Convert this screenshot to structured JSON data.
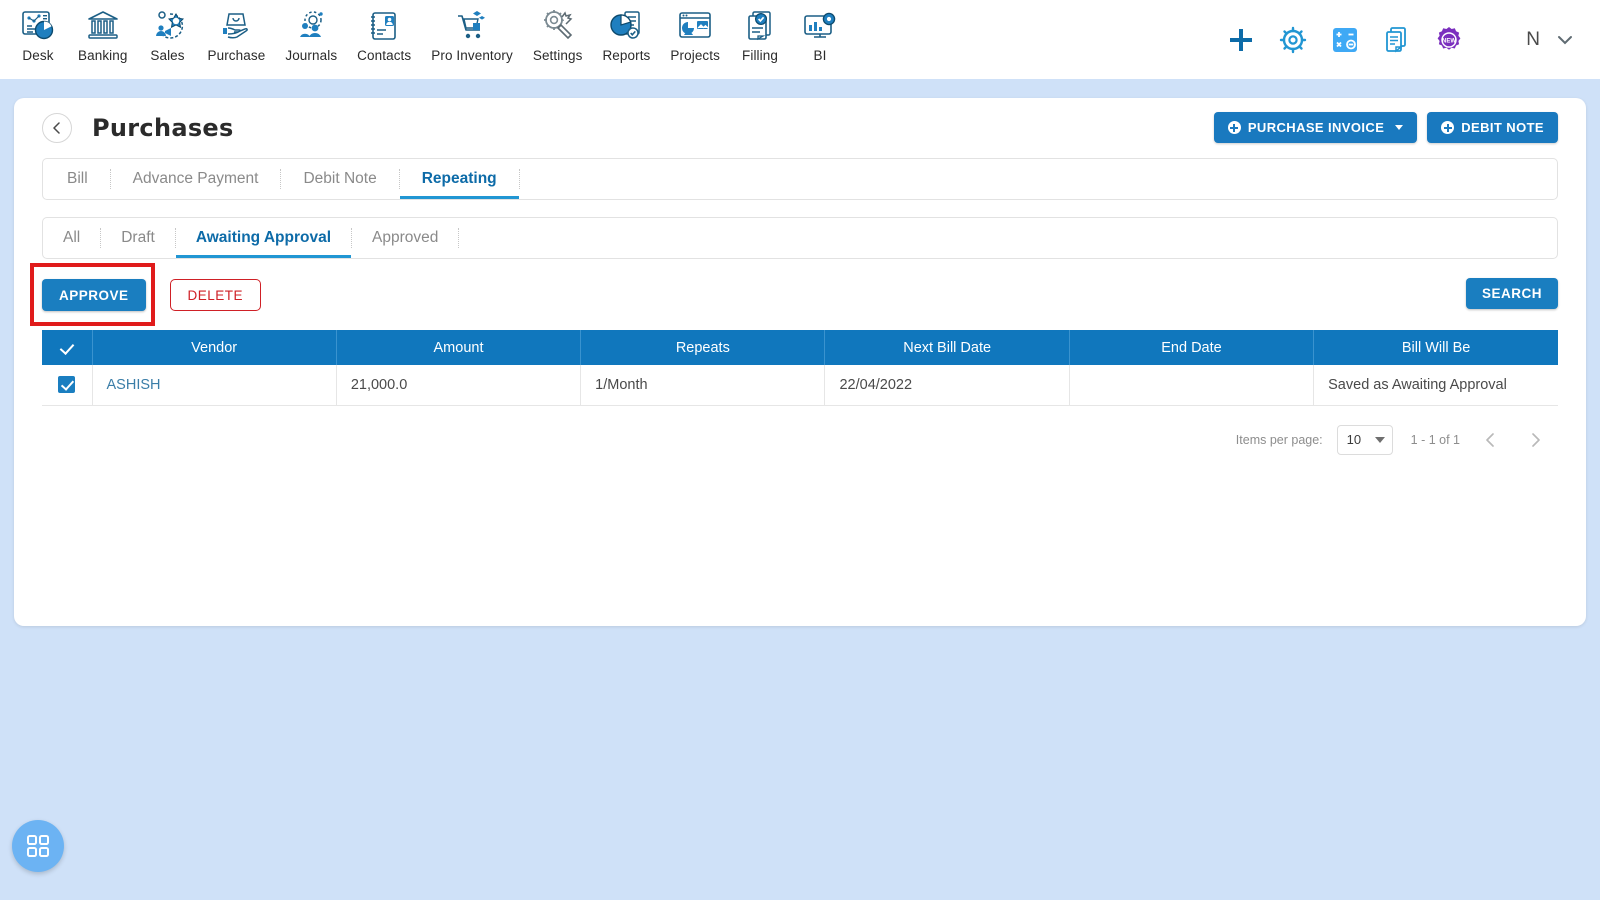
{
  "topnav": {
    "items": [
      {
        "label": "Desk",
        "icon": "dashboard-icon"
      },
      {
        "label": "Banking",
        "icon": "bank-icon"
      },
      {
        "label": "Sales",
        "icon": "sales-icon"
      },
      {
        "label": "Purchase",
        "icon": "purchase-icon"
      },
      {
        "label": "Journals",
        "icon": "journals-icon"
      },
      {
        "label": "Contacts",
        "icon": "contacts-icon"
      },
      {
        "label": "Pro Inventory",
        "icon": "inventory-icon"
      },
      {
        "label": "Settings",
        "icon": "settings-icon"
      },
      {
        "label": "Reports",
        "icon": "reports-icon"
      },
      {
        "label": "Projects",
        "icon": "projects-icon"
      },
      {
        "label": "Filling",
        "icon": "filling-icon"
      },
      {
        "label": "BI",
        "icon": "bi-icon"
      }
    ],
    "actions": [
      {
        "icon": "plus-icon"
      },
      {
        "icon": "gear-icon"
      },
      {
        "icon": "calculator-icon"
      },
      {
        "icon": "notes-icon"
      },
      {
        "icon": "new-badge-icon"
      }
    ],
    "avatar_letter": "N"
  },
  "page": {
    "title": "Purchases",
    "back_icon": "chevron-left-icon",
    "primary_buttons": [
      {
        "label": "PURCHASE INVOICE",
        "has_caret": true
      },
      {
        "label": "DEBIT NOTE",
        "has_caret": false
      }
    ]
  },
  "tabs": [
    {
      "label": "Bill",
      "active": false
    },
    {
      "label": "Advance Payment",
      "active": false
    },
    {
      "label": "Debit Note",
      "active": false
    },
    {
      "label": "Repeating",
      "active": true
    }
  ],
  "subtabs": [
    {
      "label": "All",
      "active": false
    },
    {
      "label": "Draft",
      "active": false
    },
    {
      "label": "Awaiting Approval",
      "active": true
    },
    {
      "label": "Approved",
      "active": false
    }
  ],
  "actions": {
    "approve_label": "APPROVE",
    "delete_label": "DELETE",
    "search_label": "SEARCH"
  },
  "table": {
    "columns": [
      "Vendor",
      "Amount",
      "Repeats",
      "Next Bill Date",
      "End Date",
      "Bill Will Be"
    ],
    "rows": [
      {
        "checked": true,
        "vendor": "ASHISH",
        "amount": "21,000.0",
        "repeats": "1/Month",
        "next_bill_date": "22/04/2022",
        "end_date": "",
        "bill_will_be": "Saved as Awaiting Approval"
      }
    ]
  },
  "paginator": {
    "items_per_page_label": "Items per page:",
    "items_per_page_value": "10",
    "range_label": "1 - 1 of 1"
  },
  "fab": {
    "icon": "apps-grid-icon"
  },
  "colors": {
    "page_background": "#cfe1f8",
    "accent_blue": "#1a7ec0",
    "table_header_blue": "#1077bd",
    "tab_active_blue": "#0d6ba8",
    "danger_red": "#cf2026",
    "highlight_red": "#e01b1b"
  }
}
